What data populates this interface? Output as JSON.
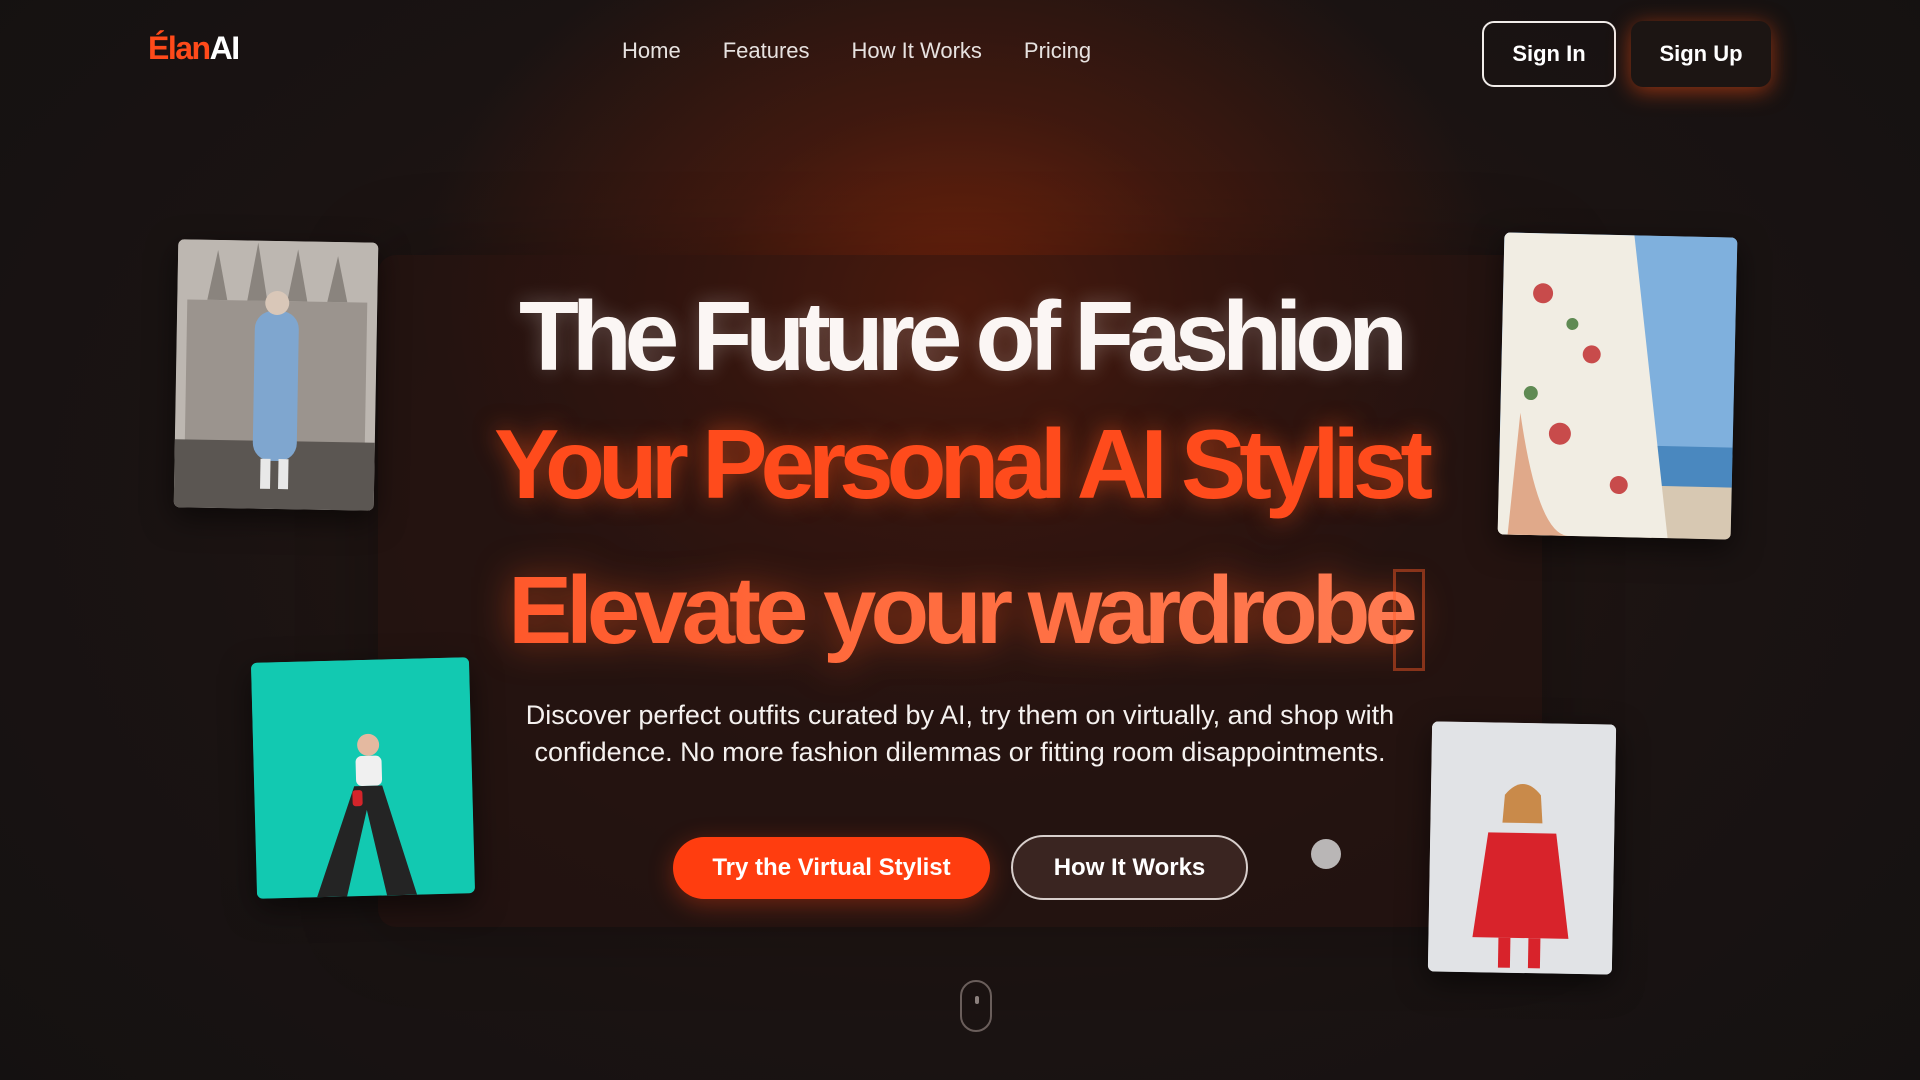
{
  "brand": {
    "logo_accent": "Élan",
    "logo_rest": "AI",
    "accent_color": "#ff4a1a"
  },
  "nav": {
    "items": [
      {
        "label": "Home"
      },
      {
        "label": "Features"
      },
      {
        "label": "How It Works"
      },
      {
        "label": "Pricing"
      }
    ],
    "sign_in": "Sign In",
    "sign_up": "Sign Up"
  },
  "hero": {
    "title_line_1": "The Future of Fashion",
    "title_line_2": "Your Personal AI Stylist",
    "typing_text": "Elevate your wardrobe",
    "description": "Discover perfect outfits curated by AI, try them on virtually, and shop with confidence. No more fashion dilemmas or fitting room disappointments.",
    "primary_cta": "Try the Virtual Stylist",
    "secondary_cta": "How It Works"
  },
  "icons": [
    "scroll-mouse-icon"
  ],
  "colors": {
    "background": "#141111",
    "primary": "#ff3d0f",
    "title": "#fbf6f4"
  }
}
